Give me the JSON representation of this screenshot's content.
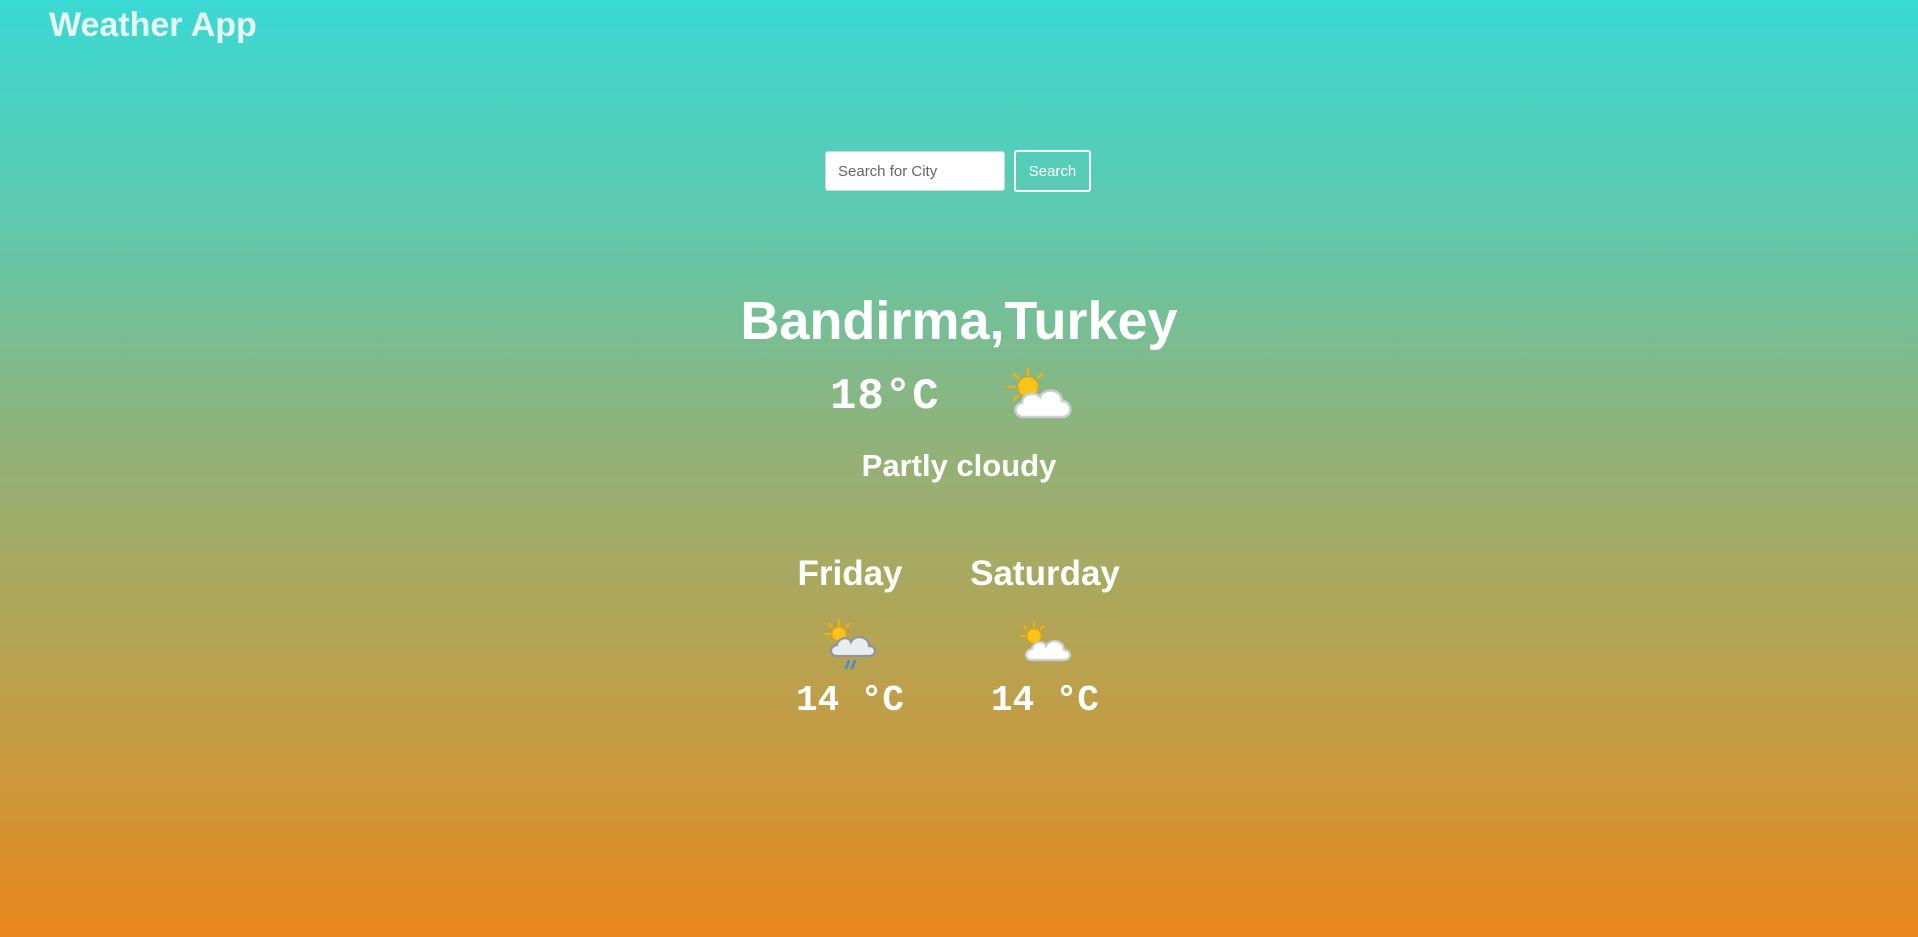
{
  "header": {
    "app_title": "Weather App"
  },
  "search": {
    "placeholder": "Search for City",
    "value": "",
    "button_label": "Search"
  },
  "current": {
    "city": "Bandirma,Turkey",
    "temperature": "18°C",
    "icon": "partly-cloudy-icon",
    "condition": "Partly cloudy"
  },
  "forecast": [
    {
      "day": "Friday",
      "icon": "rain-showers-icon",
      "temperature": "14 °C"
    },
    {
      "day": "Saturday",
      "icon": "partly-cloudy-icon",
      "temperature": "14 °C"
    }
  ],
  "colors": {
    "gradient_top": "#3ad9d3",
    "gradient_bottom": "#ea861c",
    "text": "#ffffff"
  }
}
